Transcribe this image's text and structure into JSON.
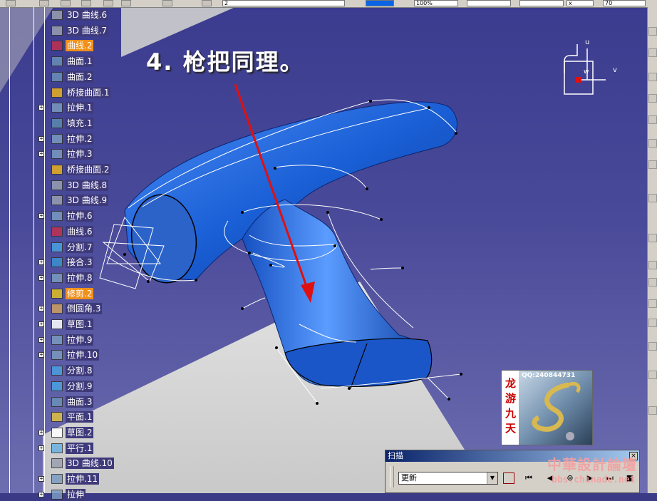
{
  "toolbar": {
    "layer_value": "2",
    "zoom_value": "100%",
    "style_value": "x",
    "extra_value": "70"
  },
  "tree": {
    "items": [
      {
        "label": "3D 曲线.6",
        "icon": "curve-3d-icon",
        "expandable": false,
        "highlight": false
      },
      {
        "label": "3D 曲线.7",
        "icon": "curve-3d-icon",
        "expandable": false,
        "highlight": false
      },
      {
        "label": "曲线.2",
        "icon": "curve-icon",
        "expandable": false,
        "highlight": true
      },
      {
        "label": "曲面.1",
        "icon": "surface-icon",
        "expandable": false,
        "highlight": false
      },
      {
        "label": "曲面.2",
        "icon": "surface-icon",
        "expandable": false,
        "highlight": false
      },
      {
        "label": "桥接曲面.1",
        "icon": "blend-surface-icon",
        "expandable": false,
        "highlight": false
      },
      {
        "label": "拉伸.1",
        "icon": "extrude-icon",
        "expandable": true,
        "highlight": false
      },
      {
        "label": "填充.1",
        "icon": "fill-icon",
        "expandable": false,
        "highlight": false
      },
      {
        "label": "拉伸.2",
        "icon": "extrude-icon",
        "expandable": true,
        "highlight": false
      },
      {
        "label": "拉伸.3",
        "icon": "extrude-icon",
        "expandable": true,
        "highlight": false
      },
      {
        "label": "桥接曲面.2",
        "icon": "blend-surface-icon",
        "expandable": false,
        "highlight": false
      },
      {
        "label": "3D 曲线.8",
        "icon": "curve-3d-icon",
        "expandable": false,
        "highlight": false
      },
      {
        "label": "3D 曲线.9",
        "icon": "curve-3d-icon",
        "expandable": false,
        "highlight": false
      },
      {
        "label": "拉伸.6",
        "icon": "extrude-icon",
        "expandable": true,
        "highlight": false
      },
      {
        "label": "曲线.6",
        "icon": "curve-icon",
        "expandable": false,
        "highlight": false
      },
      {
        "label": "分割.7",
        "icon": "split-icon",
        "expandable": false,
        "highlight": false
      },
      {
        "label": "接合.3",
        "icon": "join-icon",
        "expandable": true,
        "highlight": false
      },
      {
        "label": "拉伸.8",
        "icon": "extrude-icon",
        "expandable": true,
        "highlight": false
      },
      {
        "label": "修剪.2",
        "icon": "trim-icon",
        "expandable": false,
        "highlight": true
      },
      {
        "label": "倒圆角.3",
        "icon": "fillet-icon",
        "expandable": true,
        "highlight": false
      },
      {
        "label": "草图.1",
        "icon": "sketch-icon",
        "expandable": true,
        "highlight": false
      },
      {
        "label": "拉伸.9",
        "icon": "extrude-icon",
        "expandable": true,
        "highlight": false
      },
      {
        "label": "拉伸.10",
        "icon": "extrude-icon",
        "expandable": true,
        "highlight": false
      },
      {
        "label": "分割.8",
        "icon": "split-icon",
        "expandable": false,
        "highlight": false
      },
      {
        "label": "分割.9",
        "icon": "split-icon",
        "expandable": false,
        "highlight": false
      },
      {
        "label": "曲面.3",
        "icon": "surface-icon",
        "expandable": false,
        "highlight": false
      },
      {
        "label": "平面.1",
        "icon": "plane-icon",
        "expandable": false,
        "highlight": false
      },
      {
        "label": "草图.2",
        "icon": "sketch-icon",
        "expandable": true,
        "highlight": false
      },
      {
        "label": "平行.1",
        "icon": "parallel-icon",
        "expandable": true,
        "highlight": false
      },
      {
        "label": "3D 曲线.10",
        "icon": "curve-3d-icon",
        "expandable": false,
        "highlight": false
      },
      {
        "label": "拉伸.11",
        "icon": "extrude-icon",
        "expandable": true,
        "highlight": false
      },
      {
        "label": "拉伸",
        "icon": "extrude-icon",
        "expandable": true,
        "highlight": false
      }
    ]
  },
  "instruction": "4. 枪把同理。",
  "compass": {
    "u": "u",
    "v": "v",
    "w": "w"
  },
  "logo": {
    "qq": "QQ:240844731",
    "text": "龙游九天"
  },
  "scan_panel": {
    "title": "扫描",
    "close": "×",
    "select_value": "更新",
    "select_arrow": "▼",
    "buttons": [
      "⏮",
      "◀",
      "⊚",
      "▶",
      "⏭",
      "■"
    ]
  },
  "watermark": {
    "name": "中華設計論壇",
    "url": "bbs.chinade.net"
  },
  "colors": {
    "viewport": "#3b3b8f",
    "part": "#1a5fd6",
    "floor": "#d4d4d4",
    "arrow": "#e01010",
    "highlight": "#f0901a"
  }
}
